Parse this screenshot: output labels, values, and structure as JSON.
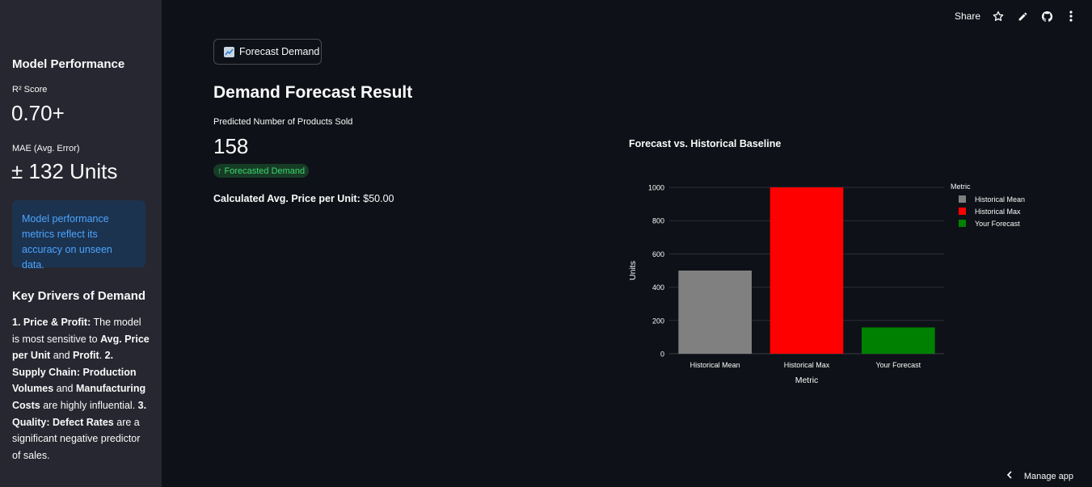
{
  "sidebar": {
    "heading": "Model Performance",
    "r2_label": "R² Score",
    "r2_value": "0.70+",
    "mae_label": "MAE (Avg. Error)",
    "mae_value": "± 132 Units",
    "info": "Model performance metrics reflect its accuracy on unseen data.",
    "drivers_heading": "Key Drivers of Demand",
    "drivers": {
      "p1_b1": "1. Price & Profit:",
      "p1_t1": " The model is most sensitive to ",
      "p1_b2": "Avg. Price per Unit",
      "p1_t2": " and ",
      "p1_b3": "Profit",
      "p1_t3": ". ",
      "p2_b1": "2. Supply Chain:",
      "p2_t1": " ",
      "p2_b2": "Production Volumes",
      "p2_t2": " and ",
      "p2_b3": "Manufacturing Costs",
      "p2_t3": " are highly influential. ",
      "p3_b1": "3. Quality:",
      "p3_t1": " ",
      "p3_b2": "Defect Rates",
      "p3_t2": " are a significant negative predictor of sales."
    }
  },
  "toolbar": {
    "share": "Share",
    "icons": [
      "star-icon",
      "pencil-icon",
      "github-icon",
      "more-vertical-icon"
    ]
  },
  "main": {
    "button_label": "Forecast Demand",
    "result_title": "Demand Forecast Result",
    "predicted_label": "Predicted Number of Products Sold",
    "predicted_value": "158",
    "delta_arrow": "↑",
    "delta_label": "Forecasted Demand",
    "avg_price_label": "Calculated Avg. Price per Unit:",
    "avg_price_value": " $50.00"
  },
  "manage_app": "Manage app",
  "chart_data": {
    "type": "bar",
    "title": "Forecast vs. Historical Baseline",
    "xlabel": "Metric",
    "ylabel": "Units",
    "categories": [
      "Historical Mean",
      "Historical Max",
      "Your Forecast"
    ],
    "values": [
      500,
      1000,
      158
    ],
    "colors": [
      "#808080",
      "#ff0000",
      "#008000"
    ],
    "ylim": [
      0,
      1000
    ],
    "yticks": [
      0,
      200,
      400,
      600,
      800,
      1000
    ],
    "grid": true,
    "legend_title": "Metric",
    "legend_position": "top-right"
  }
}
